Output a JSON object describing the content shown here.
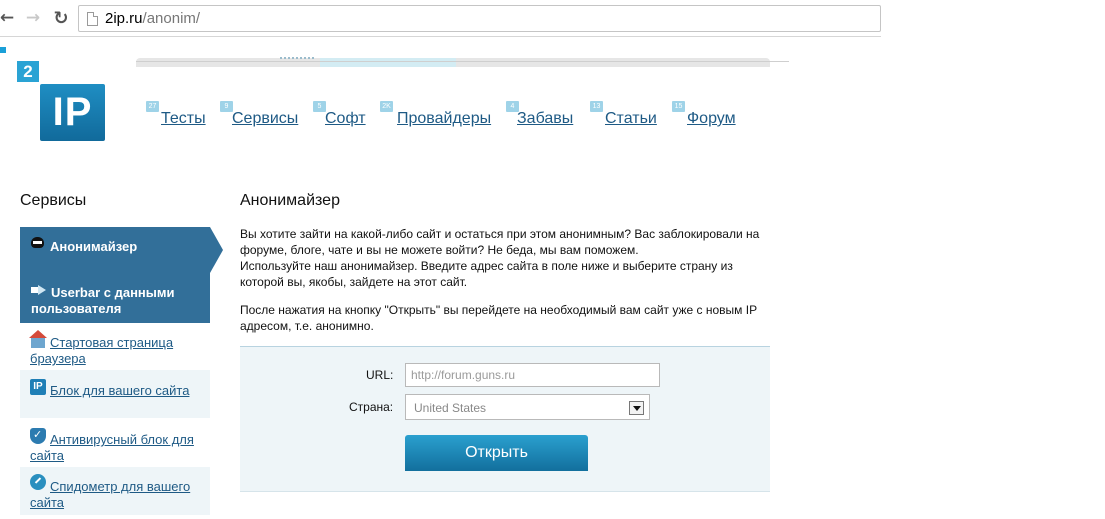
{
  "browser": {
    "url_domain": "2ip.ru",
    "url_path": "/anonim/",
    "icons": {
      "back": "arrow-left",
      "forward": "arrow-right",
      "reload": "reload",
      "page": "document"
    }
  },
  "logo": {
    "badge": "2",
    "main": "IP"
  },
  "nav": [
    {
      "label": "Тесты",
      "badge": "27"
    },
    {
      "label": "Сервисы",
      "badge": "9"
    },
    {
      "label": "Софт",
      "badge": "5"
    },
    {
      "label": "Провайдеры",
      "badge": "2K"
    },
    {
      "label": "Забавы",
      "badge": "4"
    },
    {
      "label": "Статьи",
      "badge": "13"
    },
    {
      "label": "Форум",
      "badge": "15"
    }
  ],
  "sidebar": {
    "title": "Сервисы",
    "items": [
      {
        "label": "Анонимайзер",
        "icon": "ninja-icon",
        "active": true
      },
      {
        "label": "Userbar с данными пользователя",
        "icon": "uploader-icon"
      },
      {
        "label": "Стартовая страница браузера",
        "icon": "house-icon"
      },
      {
        "label": "Блок для вашего сайта",
        "icon": "ip-icon",
        "icon_text": "IP"
      },
      {
        "label": "Антивирусный блок для сайта",
        "icon": "shield-icon"
      },
      {
        "label": "Спидометр для вашего сайта",
        "icon": "speedometer-icon"
      }
    ]
  },
  "main": {
    "title": "Анонимайзер",
    "paragraph1": "Вы хотите зайти на какой-либо сайт и остаться при этом анонимным? Вас заблокировали на форуме, блоге, чате и вы не можете войти? Не беда, мы вам поможем.",
    "paragraph2": "Используйте наш анонимайзер. Введите адрес сайта в поле ниже и выберите страну из которой вы, якобы, зайдете на этот сайт.",
    "paragraph3": "После нажатия на кнопку \"Открыть\" вы перейдете на необходимый вам сайт уже с новым IP адресом, т.е. анонимно."
  },
  "form": {
    "url_label": "URL:",
    "url_placeholder": "http://forum.guns.ru",
    "country_label": "Страна:",
    "country_value": "United States",
    "submit_label": "Открыть"
  },
  "colors": {
    "brand_blue": "#326f99",
    "link_blue": "#1e5a85",
    "panel_bg": "#eef5f8",
    "button_top": "#2aa0cf",
    "button_bottom": "#126f9d"
  }
}
